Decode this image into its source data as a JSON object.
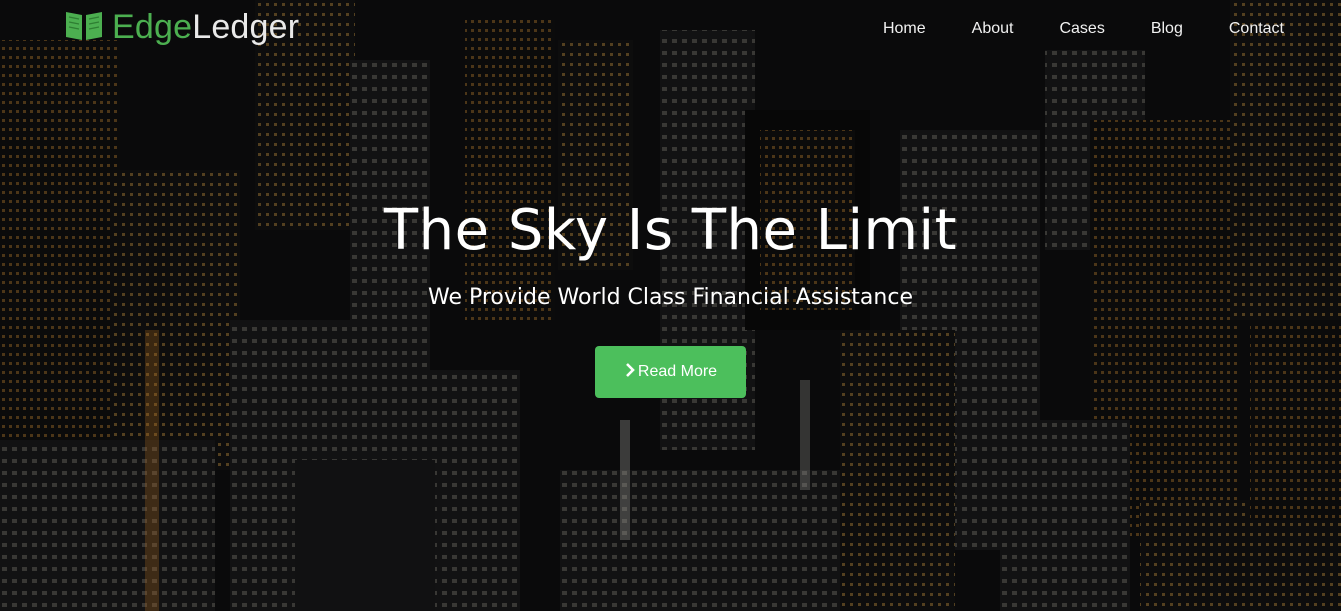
{
  "brand": {
    "name_part1": "Edge",
    "name_part2": "Ledger",
    "logo_icon": "open-book-icon",
    "accent_color": "#4caf50"
  },
  "nav": {
    "items": [
      {
        "label": "Home"
      },
      {
        "label": "About"
      },
      {
        "label": "Cases"
      },
      {
        "label": "Blog"
      },
      {
        "label": "Contact"
      }
    ]
  },
  "hero": {
    "title": "The Sky Is The Limit",
    "subtitle": "We Provide World Class Financial Assistance",
    "button_label": "Read More",
    "button_icon": "chevron-right-icon",
    "button_color": "#4cbf5c",
    "background": "night city skyline photo"
  }
}
